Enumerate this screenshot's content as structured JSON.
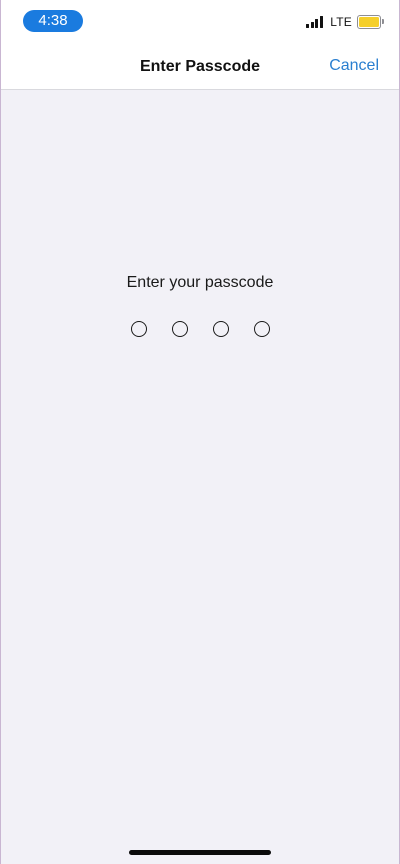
{
  "status_bar": {
    "time": "4:38",
    "network": "LTE",
    "accent_color": "#1a7bdf",
    "battery_color": "#f5cf2a",
    "icons": [
      "cellular-signal-icon",
      "battery-icon"
    ]
  },
  "nav": {
    "title": "Enter Passcode",
    "cancel_label": "Cancel",
    "link_color": "#2a7fd0"
  },
  "passcode": {
    "prompt": "Enter your passcode",
    "digits_total": 4,
    "digits_entered": 0
  }
}
